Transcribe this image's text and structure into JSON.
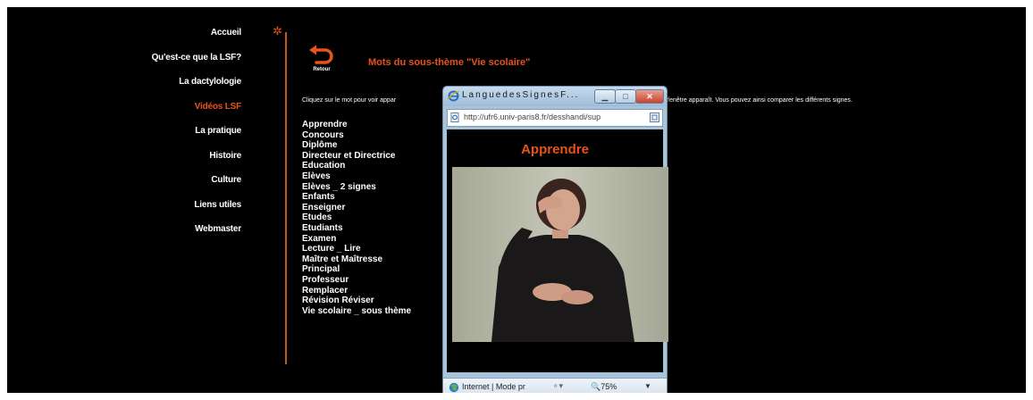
{
  "nav": {
    "items": [
      {
        "label": "Accueil"
      },
      {
        "label": "Qu'est-ce que la LSF?"
      },
      {
        "label": "La dactylologie"
      },
      {
        "label": "Vidéos LSF",
        "active": true
      },
      {
        "label": "La pratique"
      },
      {
        "label": "Histoire"
      },
      {
        "label": "Culture"
      },
      {
        "label": "Liens utiles"
      },
      {
        "label": "Webmaster"
      }
    ]
  },
  "header": {
    "back_label": "Retour",
    "title": "Mots du sous-thème \"Vie scolaire\""
  },
  "instructions": {
    "left": "Cliquez sur le mot pour voir appar",
    "right": "fenêtre apparaît. Vous pouvez ainsi comparer les différents signes."
  },
  "words": [
    "Apprendre",
    "Concours",
    "Diplôme",
    "Directeur et Directrice",
    "Education",
    "Elèves",
    "Elèves _ 2 signes",
    "Enfants",
    "Enseigner",
    "Etudes",
    "Etudiants",
    "Examen",
    "Lecture _ Lire",
    "Maître et Maîtresse",
    "Principal",
    "Professeur",
    "Remplacer",
    "Révision Réviser",
    "Vie scolaire _ sous thème"
  ],
  "popup": {
    "title": "LanguedesSignesF...",
    "url": "http://ufr6.univ-paris8.fr/desshandi/sup",
    "word": "Apprendre",
    "status": "Internet | Mode pr",
    "zoom": "75%"
  },
  "colors": {
    "accent": "#e8531b",
    "background": "#000000",
    "text": "#ffffff"
  },
  "icons": {
    "star": "star-icon",
    "back": "back-arrow-icon",
    "ie": "ie-icon",
    "globe": "globe-icon"
  }
}
